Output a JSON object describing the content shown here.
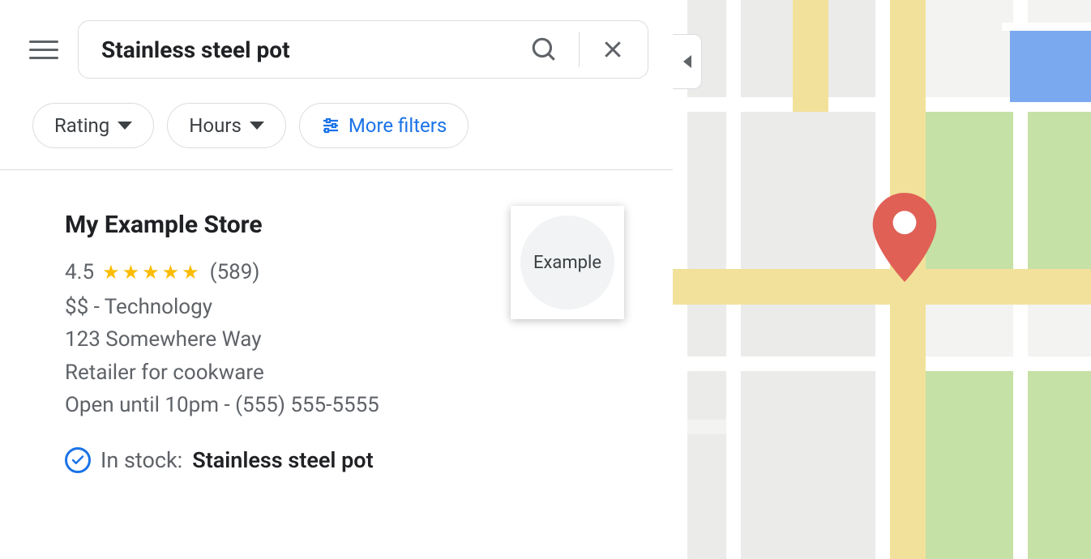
{
  "search": {
    "query": "Stainless steel pot"
  },
  "filters": {
    "rating": "Rating",
    "hours": "Hours",
    "more": "More filters"
  },
  "result": {
    "name": "My Example Store",
    "rating_value": "4.5",
    "stars": "★★★★★",
    "review_count": "(589)",
    "price_category": "$$ - Technology",
    "address": "123 Somewhere Way",
    "description": "Retailer for cookware",
    "hours_phone": "Open until 10pm - (555) 555-5555",
    "instock_label": "In stock:",
    "instock_item": "Stainless steel pot",
    "thumb_label": "Example"
  },
  "colors": {
    "accent": "#1a73e8",
    "star": "#fbbc04",
    "pin": "#e06055"
  }
}
